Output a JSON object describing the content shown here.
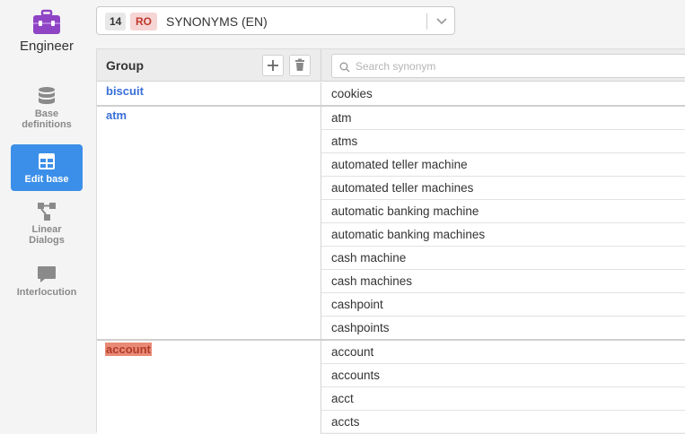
{
  "sidebar": {
    "brand_label": "Engineer",
    "items": [
      {
        "label_line1": "Base",
        "label_line2": "definitions",
        "icon": "database-icon"
      },
      {
        "label_line1": "Edit base",
        "label_line2": "",
        "icon": "table-icon"
      },
      {
        "label_line1": "Linear",
        "label_line2": "Dialogs",
        "icon": "flow-icon"
      },
      {
        "label_line1": "Interlocution",
        "label_line2": "",
        "icon": "chat-icon"
      }
    ]
  },
  "selector": {
    "count": "14",
    "lang": "RO",
    "title": "SYNONYMS (EN)"
  },
  "table": {
    "group_header": "Group",
    "search_placeholder": "Search synonym",
    "groups": [
      {
        "name": "biscuit",
        "synonyms": [
          "cookies"
        ]
      },
      {
        "name": "atm",
        "synonyms": [
          "atm",
          "atms",
          "automated teller machine",
          "automated teller machines",
          "automatic banking machine",
          "automatic banking machines",
          "cash machine",
          "cash machines",
          "cashpoint",
          "cashpoints"
        ]
      },
      {
        "name": "account",
        "synonyms": [
          "account",
          "accounts",
          "acct",
          "accts"
        ]
      }
    ]
  },
  "colors": {
    "accent": "#3b8fe8",
    "brand": "#8e44c4",
    "group_link": "#3a6fd8",
    "highlight": "#e88a76"
  }
}
